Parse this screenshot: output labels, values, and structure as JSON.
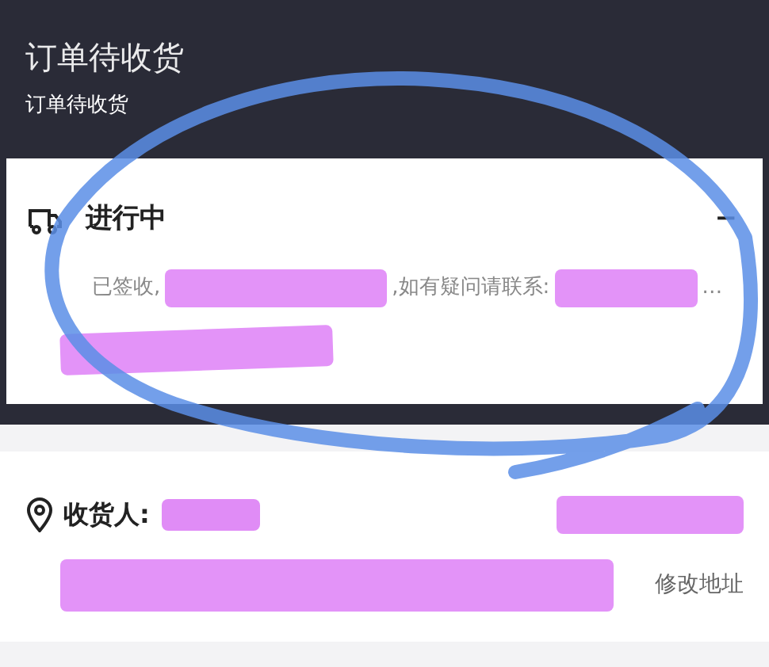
{
  "header": {
    "title": "订单待收货",
    "subtitle": "订单待收货"
  },
  "status_card": {
    "title": "进行中",
    "collapse": "−",
    "expanded": true,
    "segments": [
      "已签收,",
      ",如有疑问请联系:",
      "…"
    ]
  },
  "recipient": {
    "label": "收货人:",
    "action": "修改地址"
  }
}
